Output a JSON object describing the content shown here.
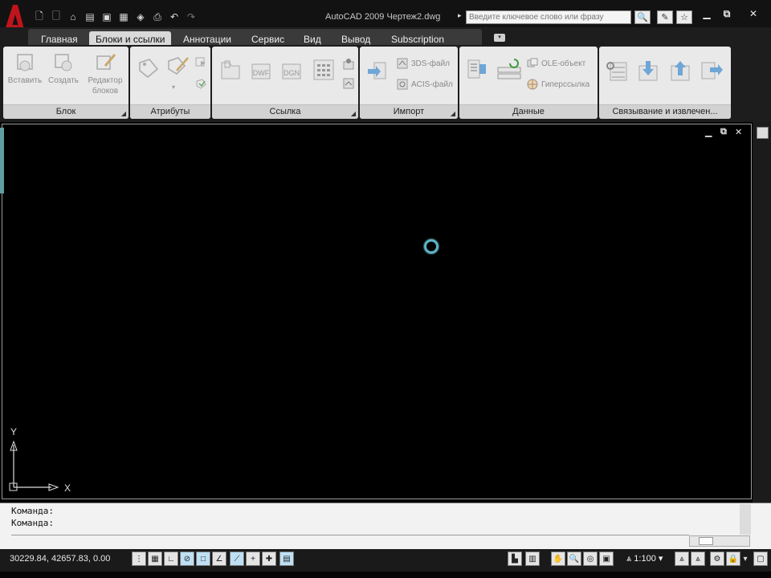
{
  "titlebar": {
    "app_name": "AutoCAD 2009",
    "document": "Чертеж2.dwg",
    "search_placeholder": "Введите ключевое слово или фразу"
  },
  "tabs": [
    {
      "label": "Главная",
      "active": false
    },
    {
      "label": "Блоки и ссылки",
      "active": true
    },
    {
      "label": "Аннотации",
      "active": false
    },
    {
      "label": "Сервис",
      "active": false
    },
    {
      "label": "Вид",
      "active": false
    },
    {
      "label": "Вывод",
      "active": false
    },
    {
      "label": "Subscription",
      "active": false
    }
  ],
  "panels": {
    "block": {
      "title": "Блок",
      "insert": "Вставить",
      "create": "Создать",
      "editor_line1": "Редактор",
      "editor_line2": "блоков"
    },
    "attributes": {
      "title": "Атрибуты"
    },
    "reference": {
      "title": "Ссылка",
      "dwf": "DWF",
      "dgn": "DGN"
    },
    "import": {
      "title": "Импорт",
      "file_3ds": "3DS-файл",
      "file_acis": "ACIS-файл"
    },
    "data": {
      "title": "Данные",
      "ole": "OLE-объект",
      "hyperlink": "Гиперссылка"
    },
    "linking": {
      "title": "Связывание и извлечен..."
    }
  },
  "command": {
    "line1": "Команда:",
    "line2": "Команда:"
  },
  "status": {
    "coords": "30229.84, 42657.83, 0.00",
    "scale": "1:100"
  },
  "colors": {
    "logo_red": "#c0141c",
    "cursor": "#5bb6c8",
    "ribbon_bg": "#e9e9e9"
  }
}
